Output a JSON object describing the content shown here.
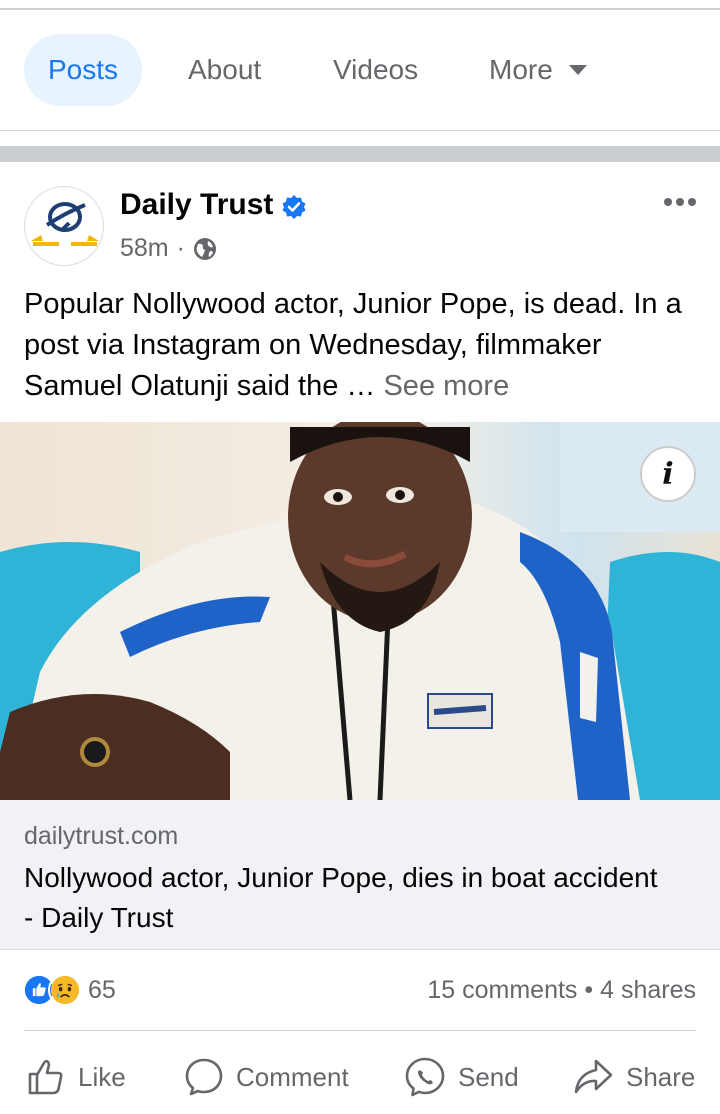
{
  "tabs": [
    {
      "label": "Posts",
      "active": true
    },
    {
      "label": "About"
    },
    {
      "label": "Videos"
    },
    {
      "label": "More"
    }
  ],
  "post": {
    "page_name": "Daily Trust",
    "verified": true,
    "time": "58m",
    "audience_icon": "globe-icon",
    "text": "Popular Nollywood actor, Junior Pope, is dead. In a post via Instagram on Wednesday, filmmaker Samuel Olatunji said the …",
    "see_more": "See more",
    "link": {
      "domain": "dailytrust.com",
      "title": "Nollywood actor, Junior Pope, dies in boat accident - Daily Trust"
    },
    "reactions": {
      "icons": [
        "like-reaction-icon",
        "sad-reaction-icon"
      ],
      "count": "65"
    },
    "comments": "15 comments",
    "separator": "•",
    "shares": "4 shares"
  },
  "actions": [
    {
      "label": "Like",
      "icon": "thumbs-up-icon"
    },
    {
      "label": "Comment",
      "icon": "comment-icon"
    },
    {
      "label": "Send",
      "icon": "messenger-icon"
    },
    {
      "label": "Share",
      "icon": "share-icon"
    }
  ],
  "colors": {
    "accent": "#1877f2",
    "secondary_text": "#65676b",
    "active_tab_bg": "#e7f3ff",
    "link_box_bg": "#f0f2f5"
  }
}
